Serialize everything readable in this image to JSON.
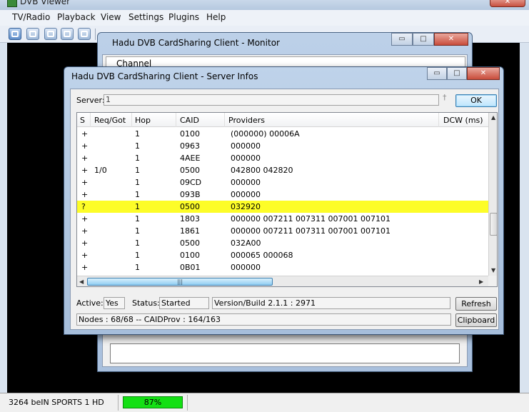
{
  "dvb": {
    "title": "DVB Viewer",
    "menu": [
      "TV/Radio",
      "Playback",
      "View",
      "Settings",
      "Plugins",
      "Help"
    ],
    "status_channel": "3264 beIN SPORTS 1 HD",
    "status_signal": "87%",
    "status_signal_fraction": 0.87,
    "close_glyph": "✕"
  },
  "monitor": {
    "title": "Hadu DVB CardSharing Client - Monitor",
    "tab_label": "Channel",
    "buttons": {
      "minimize": "▭",
      "maximize": "□",
      "close": "✕"
    }
  },
  "servinfo": {
    "title": "Hadu DVB CardSharing Client - Server Infos",
    "buttons": {
      "minimize": "▭",
      "maximize": "□",
      "close": "✕"
    },
    "server_label": "Server:",
    "server_value": "1",
    "ok_label": "OK",
    "columns": [
      "S",
      "Req/Got",
      "Hop",
      "CAID",
      "Providers",
      "DCW (ms)"
    ],
    "rows": [
      {
        "s": "+",
        "req": "",
        "hop": "1",
        "caid": "0100",
        "prov": "(000000) 00006A",
        "sel": false
      },
      {
        "s": "+",
        "req": "",
        "hop": "1",
        "caid": "0963",
        "prov": "000000",
        "sel": false
      },
      {
        "s": "+",
        "req": "",
        "hop": "1",
        "caid": "4AEE",
        "prov": "000000",
        "sel": false
      },
      {
        "s": "+",
        "req": "1/0",
        "hop": "1",
        "caid": "0500",
        "prov": "042800 042820",
        "sel": false
      },
      {
        "s": "+",
        "req": "",
        "hop": "1",
        "caid": "09CD",
        "prov": "000000",
        "sel": false
      },
      {
        "s": "+",
        "req": "",
        "hop": "1",
        "caid": "093B",
        "prov": "000000",
        "sel": false
      },
      {
        "s": "?",
        "req": "",
        "hop": "1",
        "caid": "0500",
        "prov": "032920",
        "sel": true
      },
      {
        "s": "+",
        "req": "",
        "hop": "1",
        "caid": "1803",
        "prov": "000000 007211 007311 007001 007101",
        "sel": false
      },
      {
        "s": "+",
        "req": "",
        "hop": "1",
        "caid": "1861",
        "prov": "000000 007211 007311 007001 007101",
        "sel": false
      },
      {
        "s": "+",
        "req": "",
        "hop": "1",
        "caid": "0500",
        "prov": "032A00",
        "sel": false
      },
      {
        "s": "+",
        "req": "",
        "hop": "1",
        "caid": "0100",
        "prov": "000065 000068",
        "sel": false
      },
      {
        "s": "+",
        "req": "",
        "hop": "1",
        "caid": "0B01",
        "prov": "000000",
        "sel": false
      }
    ],
    "active_label": "Active:",
    "active_value": "Yes",
    "status_label": "Status:",
    "status_value": "Started",
    "version_text": "Version/Build   2.1.1 : 2971",
    "refresh_label": "Refresh",
    "clipboard_label": "Clipboard",
    "nodes_text": "Nodes : 68/68   --   CAIDProv : 164/163",
    "scroll": {
      "up": "▲",
      "down": "▼",
      "left": "◀",
      "right": "▶",
      "grip": "|||"
    },
    "pin_glyph": "†",
    "selected_row_color": "#fdfd28"
  }
}
